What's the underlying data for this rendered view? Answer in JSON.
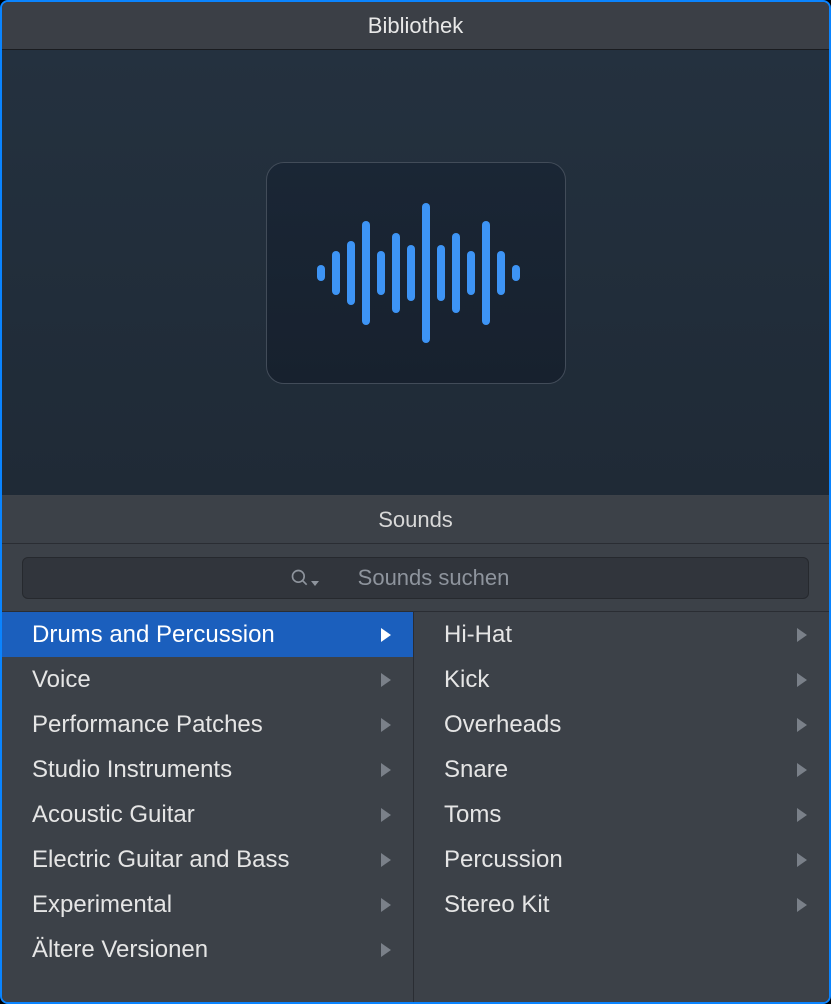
{
  "titlebar": {
    "title": "Bibliothek"
  },
  "sounds_header": {
    "label": "Sounds"
  },
  "search": {
    "placeholder": "Sounds suchen"
  },
  "categories": {
    "items": [
      {
        "label": "Drums and Percussion",
        "selected": true,
        "has_children": true
      },
      {
        "label": "Voice",
        "selected": false,
        "has_children": true
      },
      {
        "label": "Performance Patches",
        "selected": false,
        "has_children": true
      },
      {
        "label": "Studio Instruments",
        "selected": false,
        "has_children": true
      },
      {
        "label": "Acoustic Guitar",
        "selected": false,
        "has_children": true
      },
      {
        "label": "Electric Guitar and Bass",
        "selected": false,
        "has_children": true
      },
      {
        "label": "Experimental",
        "selected": false,
        "has_children": true
      },
      {
        "label": "Ältere Versionen",
        "selected": false,
        "has_children": true
      }
    ]
  },
  "subcategories": {
    "items": [
      {
        "label": "Hi-Hat",
        "has_children": true
      },
      {
        "label": "Kick",
        "has_children": true
      },
      {
        "label": "Overheads",
        "has_children": true
      },
      {
        "label": "Snare",
        "has_children": true
      },
      {
        "label": "Toms",
        "has_children": true
      },
      {
        "label": "Percussion",
        "has_children": true
      },
      {
        "label": "Stereo Kit",
        "has_children": true
      }
    ]
  },
  "icons": {
    "preview": "waveform-icon"
  },
  "colors": {
    "selection": "#1b5fbd",
    "accent": "#3d94f5",
    "window_border": "#0a84ff"
  }
}
